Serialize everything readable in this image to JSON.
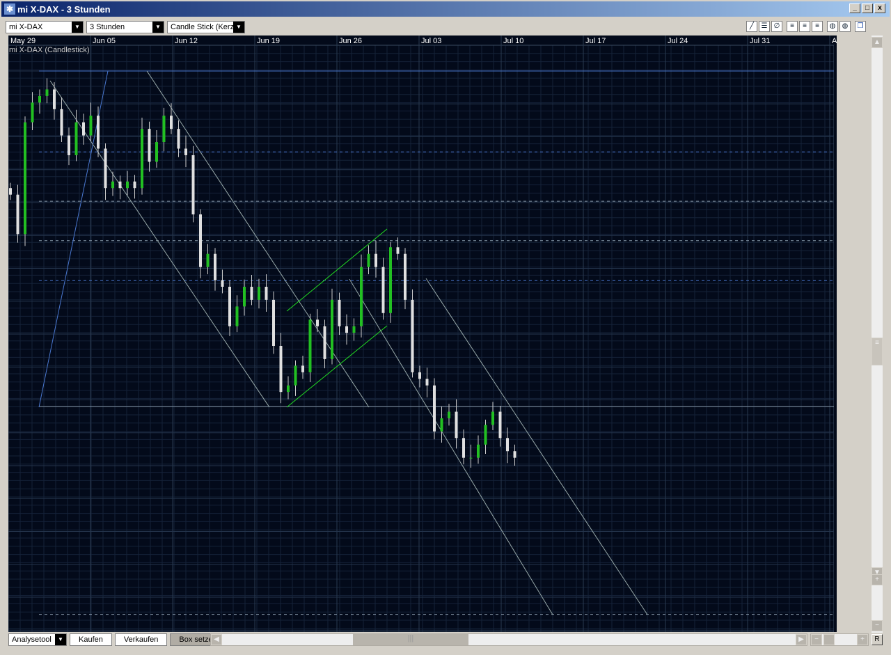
{
  "window": {
    "title": "mi X-DAX - 3 Stunden",
    "minimize": "_",
    "maximize": "□",
    "close": "x"
  },
  "toolbar": {
    "instrument": "mi X-DAX",
    "interval": "3 Stunden",
    "chart_type": "Candle Stick (Kerze"
  },
  "chart_label": "mi X-DAX (Candlestick)",
  "bottom": {
    "analysis": "Analysetool",
    "buy": "Kaufen",
    "sell": "Verkaufen",
    "box": "Box setzen",
    "reset": "R"
  },
  "colors": {
    "bg": "#030a1a",
    "up": "#22c022",
    "down": "#e0e0e0",
    "blue": "#4a78d0"
  },
  "chart_data": {
    "type": "candlestick",
    "x_ticks": [
      "May 29",
      "Jun 05",
      "Jun 12",
      "Jun 19",
      "Jun 26",
      "Jul 03",
      "Jul 10",
      "Jul 17",
      "Jul 24",
      "Jul 31",
      "A"
    ],
    "y_ticks": [
      5178.0,
      5128.0,
      5078.0,
      5028.0,
      4978.0,
      4928.0,
      4878.0,
      4828.0,
      4778.0,
      4728.0,
      4678.0,
      4628.0,
      4578.0,
      4528.0,
      4478.0,
      4428.0,
      4378.0,
      4328.0
    ],
    "ylim": [
      4328,
      5218
    ],
    "closes": [
      4990,
      4930,
      5100,
      5130,
      5140,
      5150,
      5120,
      5080,
      5050,
      5100,
      5080,
      5110,
      5060,
      5000,
      5010,
      5000,
      5010,
      5000,
      5090,
      5040,
      5070,
      5110,
      5090,
      5060,
      5050,
      4960,
      4880,
      4900,
      4860,
      4850,
      4790,
      4820,
      4850,
      4830,
      4850,
      4830,
      4760,
      4690,
      4700,
      4730,
      4720,
      4800,
      4790,
      4740,
      4830,
      4790,
      4780,
      4790,
      4880,
      4900,
      4880,
      4810,
      4910,
      4900,
      4830,
      4720,
      4710,
      4700,
      4630,
      4650,
      4660,
      4620,
      4590,
      4590,
      4610,
      4640,
      4660,
      4620,
      4600,
      4590
    ],
    "levels": [
      {
        "price": 5178,
        "style": "solid",
        "color": "#4a78d0"
      },
      {
        "price": 5055,
        "style": "dashed",
        "color": "#4a78d0"
      },
      {
        "price": 4980,
        "style": "dashed",
        "color": "#8899aa"
      },
      {
        "price": 4920,
        "style": "dashed",
        "color": "#8899aa"
      },
      {
        "price": 4860,
        "style": "dashed",
        "color": "#4a78d0"
      },
      {
        "price": 4668,
        "style": "solid",
        "color": "#8899aa"
      },
      {
        "price": 4352,
        "style": "dashed",
        "color": "#8899aa"
      }
    ]
  }
}
